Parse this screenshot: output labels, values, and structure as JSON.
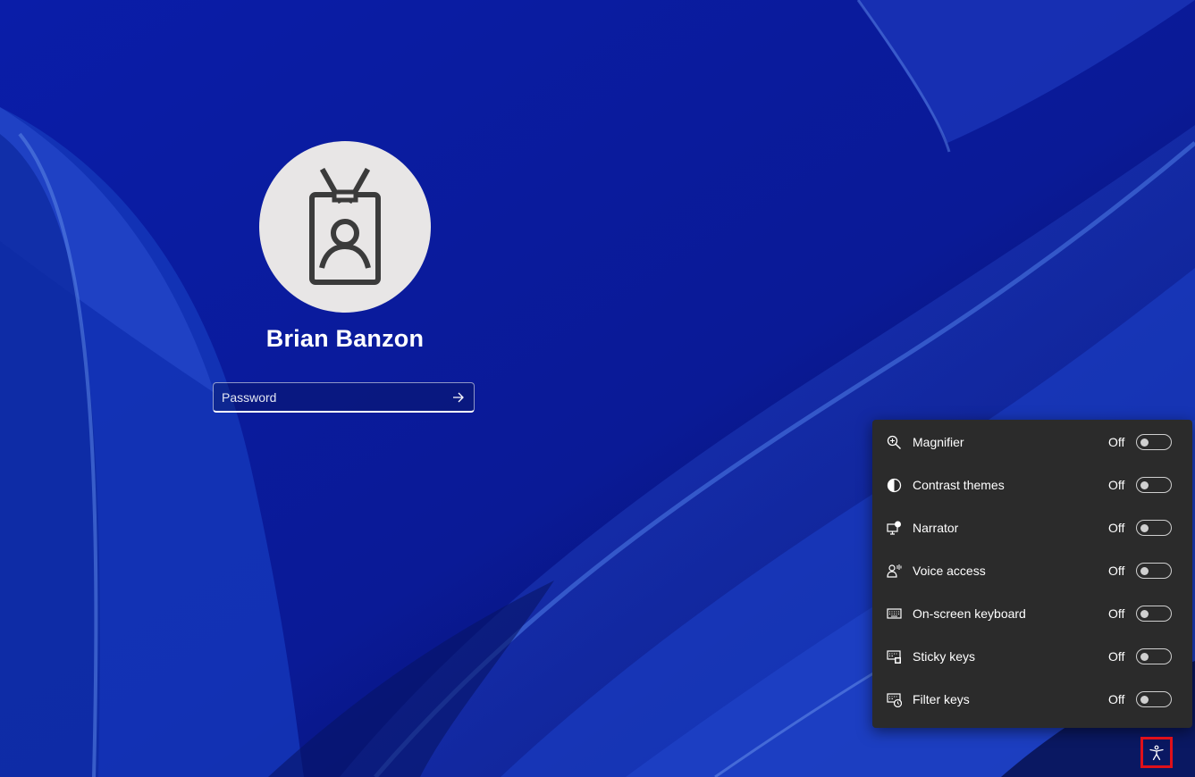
{
  "user": {
    "name": "Brian Banzon",
    "avatar_icon": "id-badge-icon"
  },
  "password": {
    "placeholder": "Password",
    "submit_icon": "arrow-right-icon"
  },
  "accessibility_panel": {
    "items": [
      {
        "label": "Magnifier",
        "state": "Off",
        "icon": "magnifier-icon",
        "on": false
      },
      {
        "label": "Contrast themes",
        "state": "Off",
        "icon": "contrast-icon",
        "on": false
      },
      {
        "label": "Narrator",
        "state": "Off",
        "icon": "narrator-icon",
        "on": false
      },
      {
        "label": "Voice access",
        "state": "Off",
        "icon": "voice-access-icon",
        "on": false
      },
      {
        "label": "On-screen keyboard",
        "state": "Off",
        "icon": "keyboard-icon",
        "on": false
      },
      {
        "label": "Sticky keys",
        "state": "Off",
        "icon": "sticky-keys-icon",
        "on": false
      },
      {
        "label": "Filter keys",
        "state": "Off",
        "icon": "filter-keys-icon",
        "on": false
      }
    ]
  },
  "accessibility_button": {
    "icon": "accessibility-icon",
    "highlight_color": "#e0101a"
  },
  "colors": {
    "wallpaper_base": "#0a1a8c",
    "panel_background": "#2b2b2b"
  }
}
